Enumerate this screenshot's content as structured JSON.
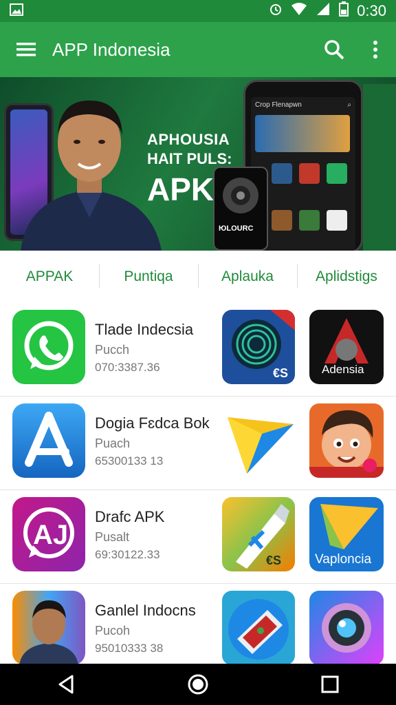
{
  "status_bar": {
    "time": "0:30",
    "icons": [
      "image-icon",
      "alarm-icon",
      "wifi-icon",
      "signal-icon",
      "battery-icon"
    ]
  },
  "app_bar": {
    "title": "APP Indonesia",
    "icons": [
      "menu-icon",
      "search-icon",
      "more-vert-icon"
    ]
  },
  "banner": {
    "line1": "APHOUSIA",
    "line2": "HAIT PULS:",
    "line3": "APK",
    "phone_header": "Crop Flenapwn",
    "small_phone_text": "ЮLOURC"
  },
  "tabs": [
    "APPAK",
    "Puntiqa",
    "Aplauka",
    "Aplidstigs"
  ],
  "apps": [
    {
      "name": "Tlade Indecsia",
      "sub": "Pucch",
      "num": "070:3387.36",
      "icon": "whatsapp-icon",
      "tile2": "spiral-app-icon",
      "tile2_label": "€S",
      "tile3": "adensia-app-icon",
      "tile3_label": "Adensia"
    },
    {
      "name": "Dogia Fɛdca Bok",
      "sub": "Puach",
      "num": "65300133 13",
      "icon": "app-store-icon",
      "tile2": "play-triangle-icon",
      "tile2_label": "",
      "tile3": "cartoon-boy-icon",
      "tile3_label": ""
    },
    {
      "name": "Drafc APK",
      "sub": "Pusalt",
      "num": "69:30122.33",
      "icon": "chat-a-icon",
      "tile2": "syringe-app-icon",
      "tile2_label": "€S",
      "tile3": "vaploncia-icon",
      "tile3_label": "Vaploncia"
    },
    {
      "name": "Ganlel Indocns",
      "sub": "Pucoh",
      "num": "95010333 38",
      "icon": "portrait-icon",
      "tile2": "phone-tool-icon",
      "tile2_label": "",
      "tile3": "camera-lens-icon",
      "tile3_label": ""
    }
  ],
  "nav": [
    "back-icon",
    "home-icon",
    "recents-icon"
  ],
  "colors": {
    "status_bar": "#1f8a3a",
    "app_bar": "#2da24a",
    "tab_text": "#1f8a3a"
  }
}
